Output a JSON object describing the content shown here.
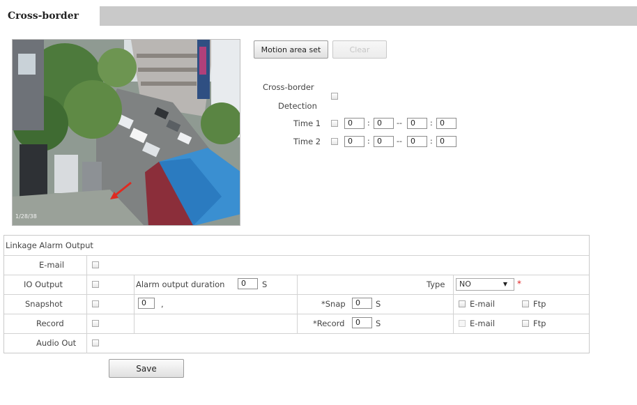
{
  "header": {
    "title": "Cross-border",
    "bar_color": "#c9c9c9"
  },
  "preview": {
    "timestamp_overlay": "1/28/38"
  },
  "controls": {
    "motion_area_set_label": "Motion area set",
    "clear_label": "Clear",
    "cross_border_label_line1": "Cross-border",
    "cross_border_label_line2": "Detection",
    "cross_border_checked": false,
    "time1": {
      "label": "Time 1",
      "checked": false,
      "start_h": "0",
      "start_m": "0",
      "end_h": "0",
      "end_m": "0"
    },
    "time2": {
      "label": "Time 2",
      "checked": false,
      "start_h": "0",
      "start_m": "0",
      "end_h": "0",
      "end_m": "0"
    },
    "colon": ":",
    "dash": "--"
  },
  "linkage": {
    "header": "Linkage Alarm Output",
    "email_label": "E-mail",
    "io_output_label": "IO Output",
    "alarm_duration_label": "Alarm output duration",
    "alarm_duration_value": "0",
    "alarm_duration_unit": "S",
    "type_label": "Type",
    "type_selected": "NO",
    "required_mark": "*",
    "snapshot_label": "Snapshot",
    "snapshot_value": "0",
    "snapshot_sep": ",",
    "snap_label": "*Snap",
    "snap_value": "0",
    "snap_unit": "S",
    "snap_email": "E-mail",
    "snap_ftp": "Ftp",
    "record_label": "Record",
    "record_sub_label": "*Record",
    "record_value": "0",
    "record_unit": "S",
    "record_email": "E-mail",
    "record_ftp": "Ftp",
    "audio_out_label": "Audio Out"
  },
  "footer": {
    "save_label": "Save"
  },
  "colors": {
    "required": "#e02020",
    "table_border": "#c9c9c9"
  }
}
